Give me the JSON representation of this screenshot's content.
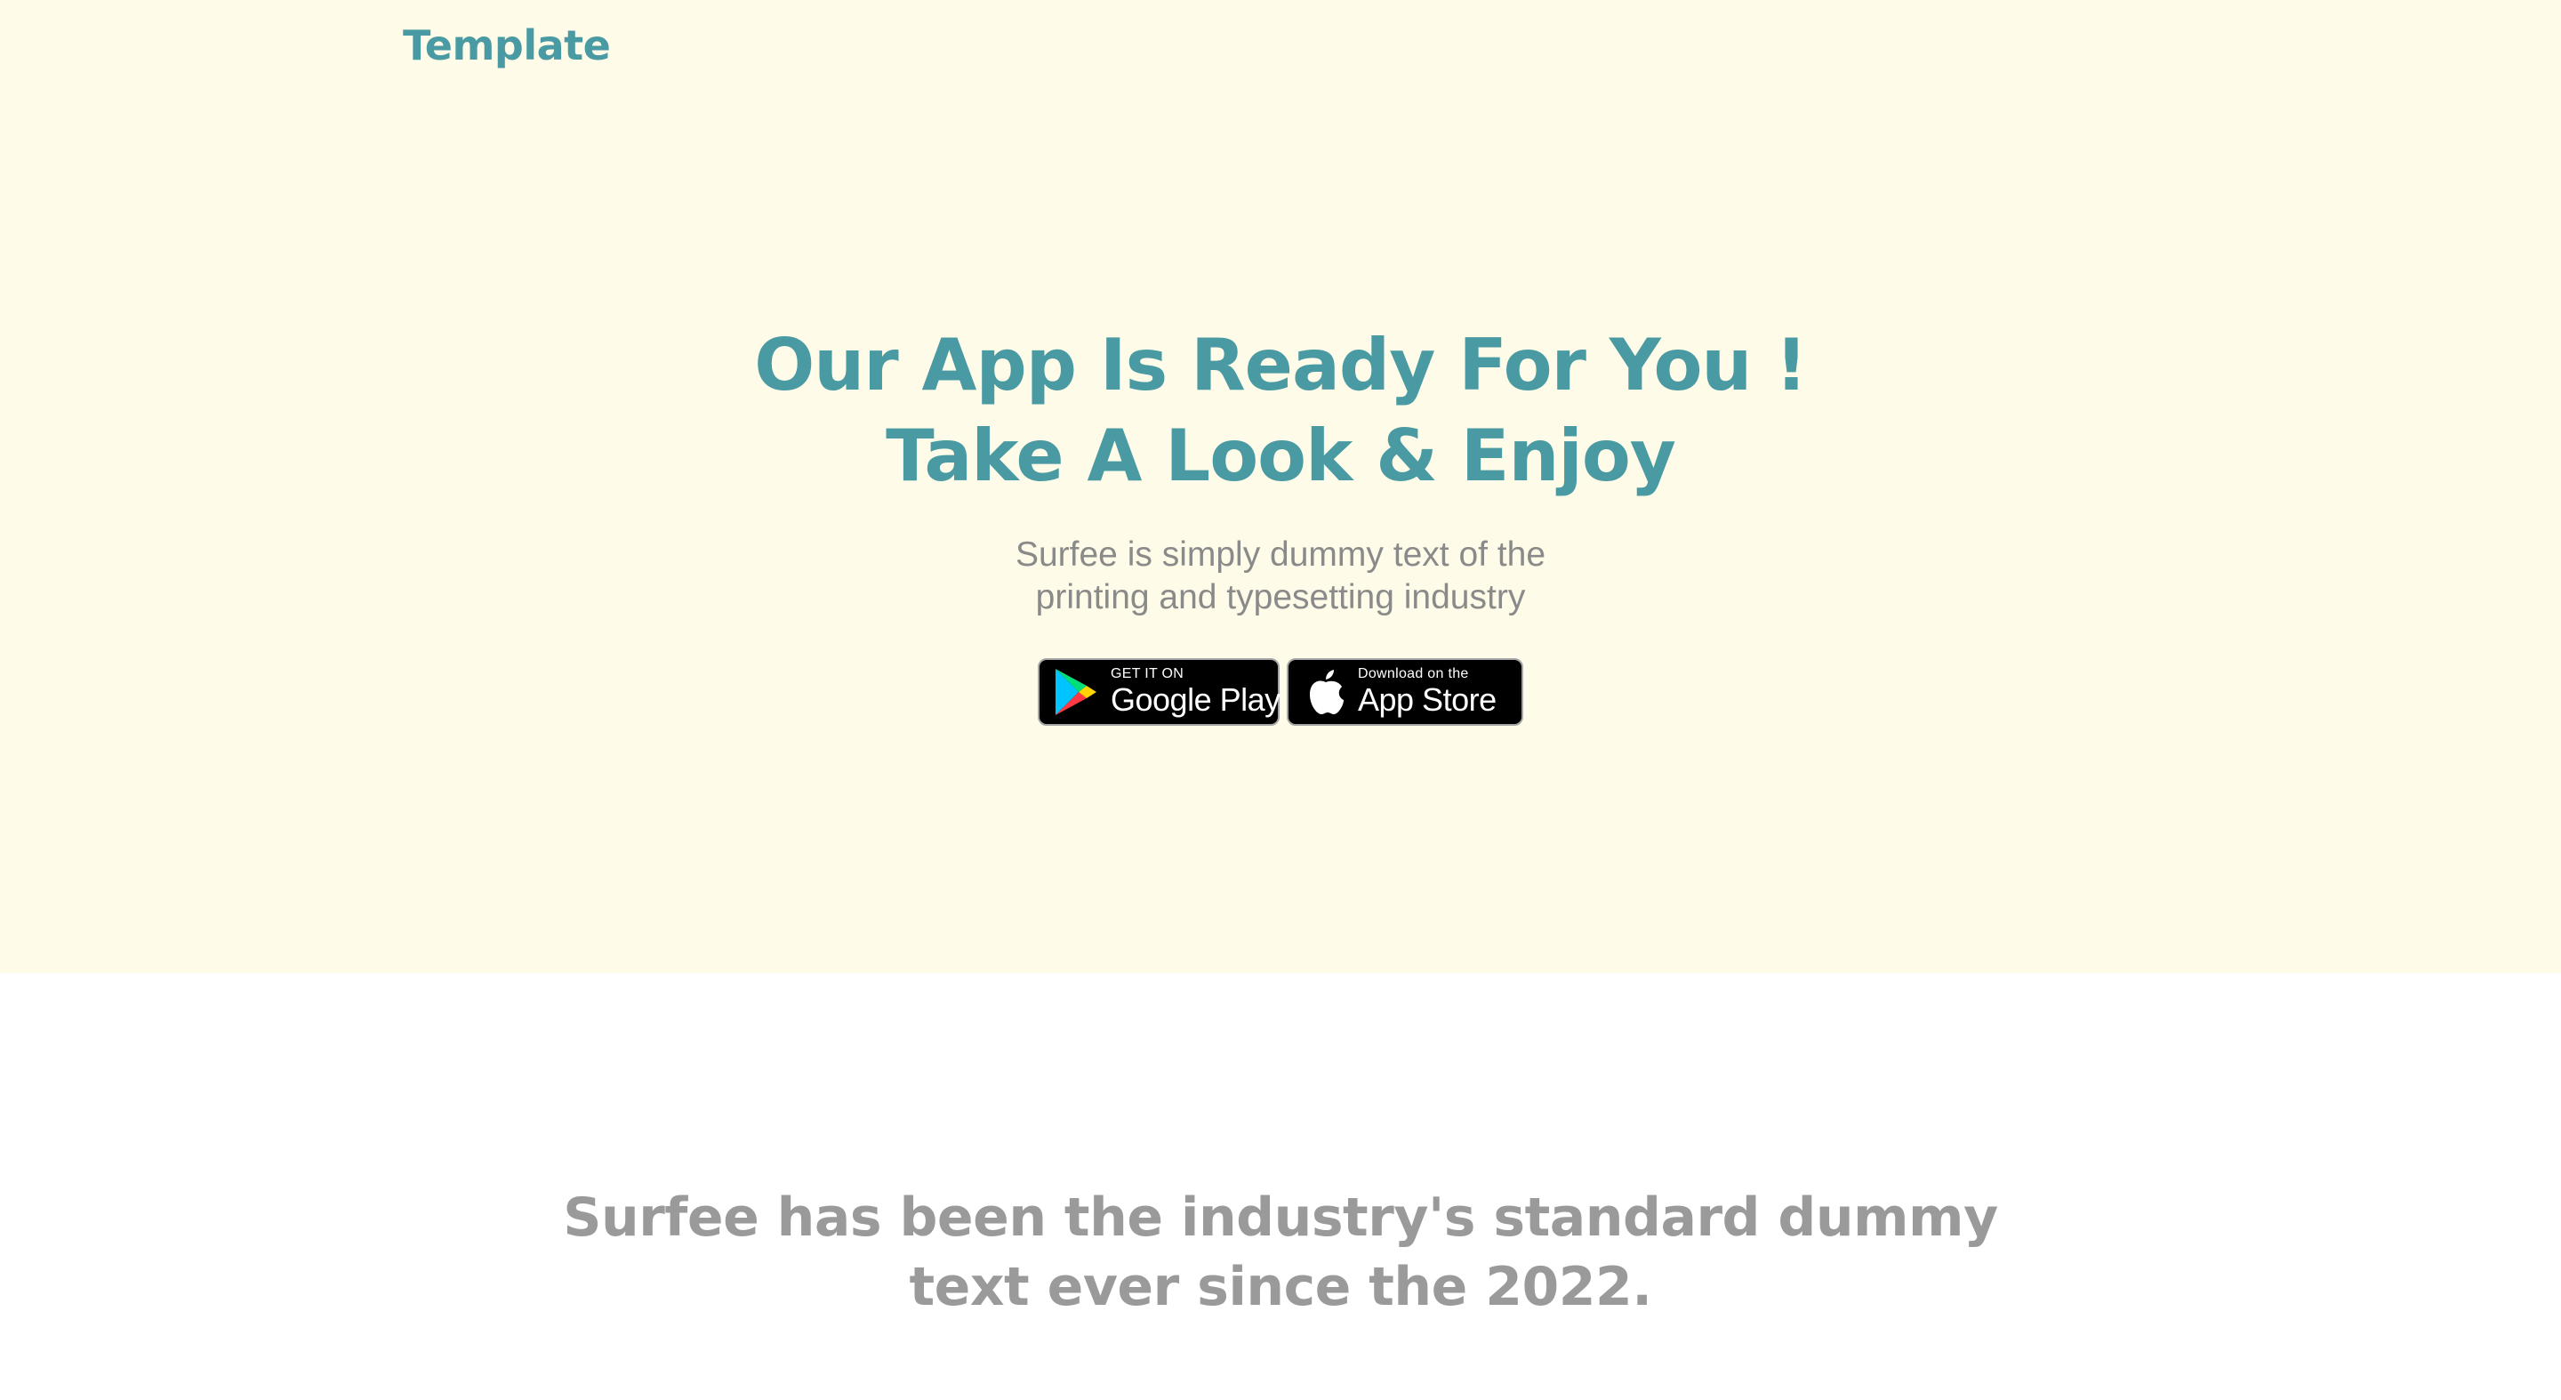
{
  "brand": {
    "name": "Template"
  },
  "hero": {
    "headline_line1": "Our App Is Ready For You !",
    "headline_line2": "Take A Look & Enjoy",
    "subtext_line1": "Surfee is simply dummy text of the",
    "subtext_line2": "printing and typesetting industry",
    "background": "#fefce8",
    "accent": "#4a9aa3"
  },
  "store_badges": {
    "google_play": {
      "small": "GET IT ON",
      "big": "Google Play",
      "icon": "google-play-icon"
    },
    "app_store": {
      "small": "Download on the",
      "big": "App Store",
      "icon": "apple-icon"
    }
  },
  "section2": {
    "line1": "Surfee has been the industry's standard dummy",
    "line2": "text ever since the 2022."
  }
}
